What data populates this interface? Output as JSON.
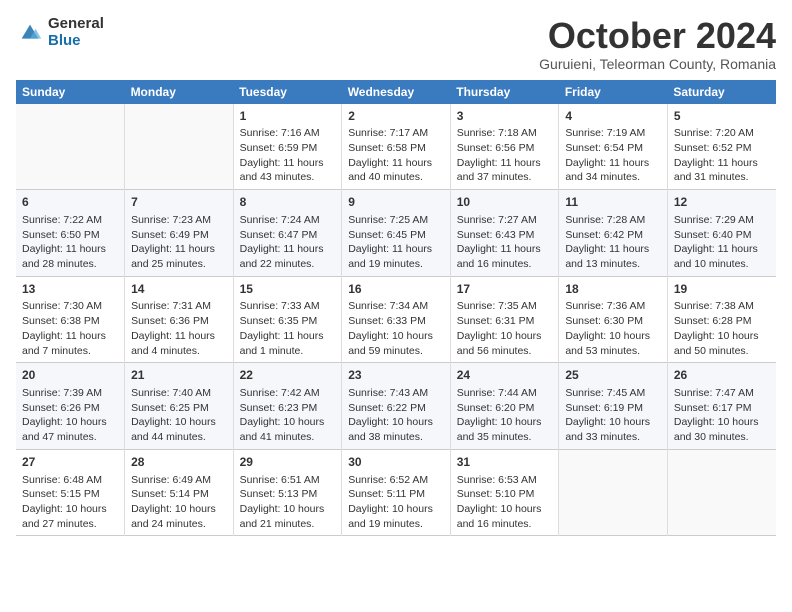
{
  "logo": {
    "general": "General",
    "blue": "Blue"
  },
  "title": "October 2024",
  "subtitle": "Guruieni, Teleorman County, Romania",
  "weekdays": [
    "Sunday",
    "Monday",
    "Tuesday",
    "Wednesday",
    "Thursday",
    "Friday",
    "Saturday"
  ],
  "weeks": [
    [
      {
        "day": "",
        "info": ""
      },
      {
        "day": "",
        "info": ""
      },
      {
        "day": "1",
        "info": "Sunrise: 7:16 AM\nSunset: 6:59 PM\nDaylight: 11 hours and 43 minutes."
      },
      {
        "day": "2",
        "info": "Sunrise: 7:17 AM\nSunset: 6:58 PM\nDaylight: 11 hours and 40 minutes."
      },
      {
        "day": "3",
        "info": "Sunrise: 7:18 AM\nSunset: 6:56 PM\nDaylight: 11 hours and 37 minutes."
      },
      {
        "day": "4",
        "info": "Sunrise: 7:19 AM\nSunset: 6:54 PM\nDaylight: 11 hours and 34 minutes."
      },
      {
        "day": "5",
        "info": "Sunrise: 7:20 AM\nSunset: 6:52 PM\nDaylight: 11 hours and 31 minutes."
      }
    ],
    [
      {
        "day": "6",
        "info": "Sunrise: 7:22 AM\nSunset: 6:50 PM\nDaylight: 11 hours and 28 minutes."
      },
      {
        "day": "7",
        "info": "Sunrise: 7:23 AM\nSunset: 6:49 PM\nDaylight: 11 hours and 25 minutes."
      },
      {
        "day": "8",
        "info": "Sunrise: 7:24 AM\nSunset: 6:47 PM\nDaylight: 11 hours and 22 minutes."
      },
      {
        "day": "9",
        "info": "Sunrise: 7:25 AM\nSunset: 6:45 PM\nDaylight: 11 hours and 19 minutes."
      },
      {
        "day": "10",
        "info": "Sunrise: 7:27 AM\nSunset: 6:43 PM\nDaylight: 11 hours and 16 minutes."
      },
      {
        "day": "11",
        "info": "Sunrise: 7:28 AM\nSunset: 6:42 PM\nDaylight: 11 hours and 13 minutes."
      },
      {
        "day": "12",
        "info": "Sunrise: 7:29 AM\nSunset: 6:40 PM\nDaylight: 11 hours and 10 minutes."
      }
    ],
    [
      {
        "day": "13",
        "info": "Sunrise: 7:30 AM\nSunset: 6:38 PM\nDaylight: 11 hours and 7 minutes."
      },
      {
        "day": "14",
        "info": "Sunrise: 7:31 AM\nSunset: 6:36 PM\nDaylight: 11 hours and 4 minutes."
      },
      {
        "day": "15",
        "info": "Sunrise: 7:33 AM\nSunset: 6:35 PM\nDaylight: 11 hours and 1 minute."
      },
      {
        "day": "16",
        "info": "Sunrise: 7:34 AM\nSunset: 6:33 PM\nDaylight: 10 hours and 59 minutes."
      },
      {
        "day": "17",
        "info": "Sunrise: 7:35 AM\nSunset: 6:31 PM\nDaylight: 10 hours and 56 minutes."
      },
      {
        "day": "18",
        "info": "Sunrise: 7:36 AM\nSunset: 6:30 PM\nDaylight: 10 hours and 53 minutes."
      },
      {
        "day": "19",
        "info": "Sunrise: 7:38 AM\nSunset: 6:28 PM\nDaylight: 10 hours and 50 minutes."
      }
    ],
    [
      {
        "day": "20",
        "info": "Sunrise: 7:39 AM\nSunset: 6:26 PM\nDaylight: 10 hours and 47 minutes."
      },
      {
        "day": "21",
        "info": "Sunrise: 7:40 AM\nSunset: 6:25 PM\nDaylight: 10 hours and 44 minutes."
      },
      {
        "day": "22",
        "info": "Sunrise: 7:42 AM\nSunset: 6:23 PM\nDaylight: 10 hours and 41 minutes."
      },
      {
        "day": "23",
        "info": "Sunrise: 7:43 AM\nSunset: 6:22 PM\nDaylight: 10 hours and 38 minutes."
      },
      {
        "day": "24",
        "info": "Sunrise: 7:44 AM\nSunset: 6:20 PM\nDaylight: 10 hours and 35 minutes."
      },
      {
        "day": "25",
        "info": "Sunrise: 7:45 AM\nSunset: 6:19 PM\nDaylight: 10 hours and 33 minutes."
      },
      {
        "day": "26",
        "info": "Sunrise: 7:47 AM\nSunset: 6:17 PM\nDaylight: 10 hours and 30 minutes."
      }
    ],
    [
      {
        "day": "27",
        "info": "Sunrise: 6:48 AM\nSunset: 5:15 PM\nDaylight: 10 hours and 27 minutes."
      },
      {
        "day": "28",
        "info": "Sunrise: 6:49 AM\nSunset: 5:14 PM\nDaylight: 10 hours and 24 minutes."
      },
      {
        "day": "29",
        "info": "Sunrise: 6:51 AM\nSunset: 5:13 PM\nDaylight: 10 hours and 21 minutes."
      },
      {
        "day": "30",
        "info": "Sunrise: 6:52 AM\nSunset: 5:11 PM\nDaylight: 10 hours and 19 minutes."
      },
      {
        "day": "31",
        "info": "Sunrise: 6:53 AM\nSunset: 5:10 PM\nDaylight: 10 hours and 16 minutes."
      },
      {
        "day": "",
        "info": ""
      },
      {
        "day": "",
        "info": ""
      }
    ]
  ]
}
